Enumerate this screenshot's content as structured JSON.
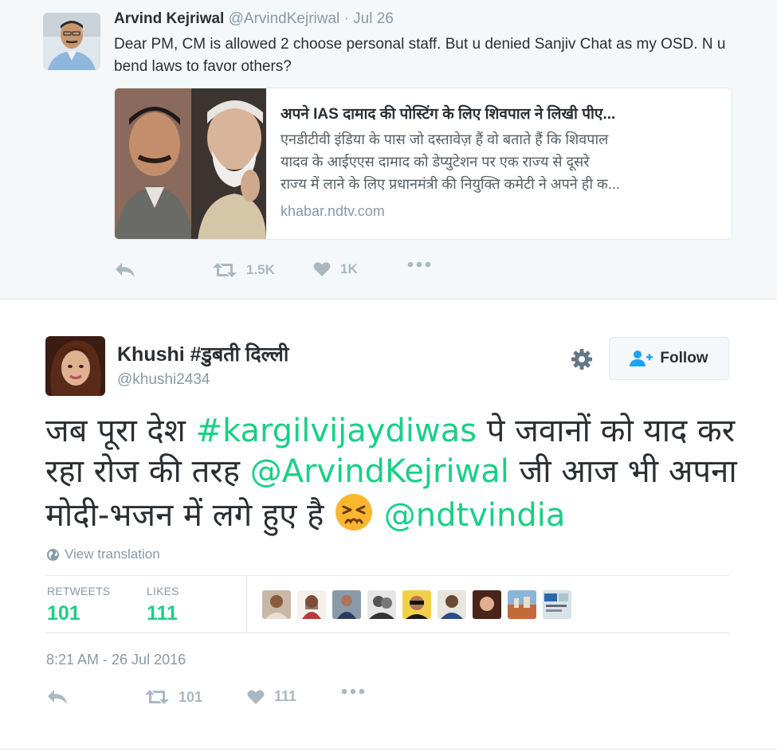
{
  "quoted_tweet": {
    "author_name": "Arvind Kejriwal",
    "author_handle": "@ArvindKejriwal",
    "date": "· Jul 26",
    "text": "Dear PM, CM is allowed 2 choose personal staff. But u denied Sanjiv Chat as my OSD. N u bend laws to favor others?",
    "card": {
      "title": "अपने IAS दामाद की पोस्टिंग के लिए शिवपाल ने लिखी पीए...",
      "description_lines": [
        "एनडीटीवी इंडिया के पास जो दस्तावेज़ हैं वो बताते हैं कि शिवपाल",
        "यादव के आईएएस दामाद को डेप्युटेशन पर एक राज्य से दूसरे",
        "राज्य में लाने के लिए प्रधानमंत्री की नियुक्ति कमेटी ने अपने ही क..."
      ],
      "domain": "khabar.ndtv.com"
    },
    "actions": {
      "reply_icon": "reply-icon",
      "retweet_icon": "retweet-icon",
      "retweet_count": "1.5K",
      "like_icon": "heart-icon",
      "like_count": "1K",
      "more_icon": "more-icon"
    }
  },
  "main_tweet": {
    "author_name": "Khushi #डुबती दिल्ली",
    "author_handle": "@khushi2434",
    "follow_label": "Follow",
    "text_parts": {
      "p1": "जब पूरा देश ",
      "hashtag": "#kargilvijaydiwas",
      "p2": " पे जवानों को याद कर रहा रोज की तरह ",
      "mention1": "@ArvindKejriwal",
      "p3": " जी आज भी अपना मोदी-भजन में लगे हुए है ",
      "emoji": "persevering-face-emoji",
      "mention2": "@ndtvindia"
    },
    "view_translation": "View translation",
    "stats": {
      "retweets_label": "RETWEETS",
      "retweets_value": "101",
      "likes_label": "LIKES",
      "likes_value": "111"
    },
    "timestamp": "8:21 AM - 26 Jul 2016",
    "actions": {
      "retweet_count": "101",
      "like_count": "111"
    }
  },
  "colors": {
    "accent": "#19cf86",
    "muted": "#8899a6",
    "icon": "#aab8c2",
    "quoted_bg": "#f5f8fa"
  }
}
